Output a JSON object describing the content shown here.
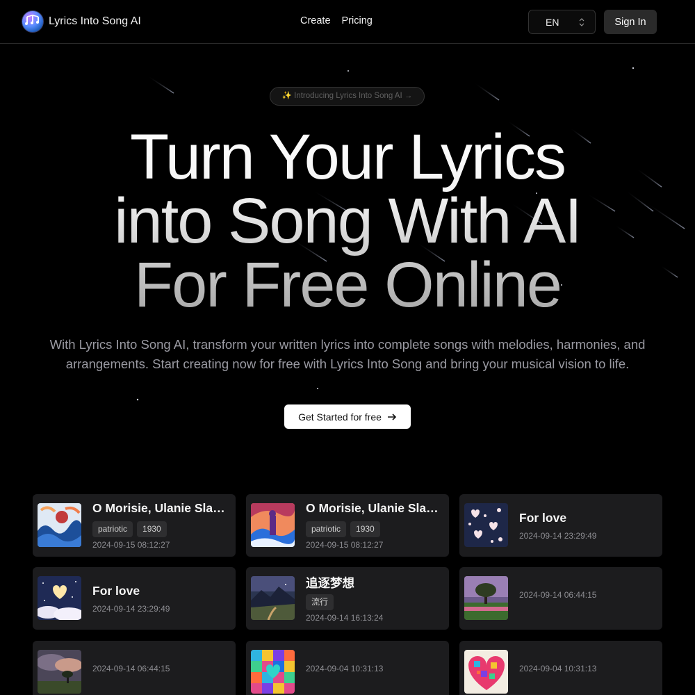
{
  "header": {
    "brand": "Lyrics Into Song AI",
    "nav": [
      "Create",
      "Pricing"
    ],
    "language": "EN",
    "signin": "Sign In"
  },
  "hero": {
    "badge": "✨ Introducing Lyrics Into Song AI →",
    "title_lines": [
      "Turn Your Lyrics",
      "into Song With AI",
      "For Free Online"
    ],
    "subtitle": "With Lyrics Into Song AI, transform your written lyrics into complete songs with melodies, harmonies, and arrangements. Start creating now for free with Lyrics Into Song and bring your musical vision to life.",
    "cta": "Get Started for free"
  },
  "songs": [
    {
      "title": "O Morisie, Ulanie Slawa Twej",
      "tags": [
        "patriotic",
        "1930"
      ],
      "date": "2024-09-15 08:12:27",
      "art": "waves"
    },
    {
      "title": "O Morisie, Ulanie Slawa Twej",
      "tags": [
        "patriotic",
        "1930"
      ],
      "date": "2024-09-15 08:12:27",
      "art": "waves2"
    },
    {
      "title": "For love",
      "tags": [],
      "date": "2024-09-14 23:29:49",
      "art": "hearts"
    },
    {
      "title": "For love",
      "tags": [],
      "date": "2024-09-14 23:29:49",
      "art": "heart-sky"
    },
    {
      "title": "追逐梦想",
      "tags": [
        "流行"
      ],
      "date": "2024-09-14 16:13:24",
      "art": "mountain"
    },
    {
      "title": "",
      "tags": [],
      "date": "2024-09-14 06:44:15",
      "art": "tree"
    },
    {
      "title": "",
      "tags": [],
      "date": "2024-09-14 06:44:15",
      "art": "storm"
    },
    {
      "title": "",
      "tags": [],
      "date": "2024-09-04 10:31:13",
      "art": "mosaic"
    },
    {
      "title": "",
      "tags": [],
      "date": "2024-09-04 10:31:13",
      "art": "mosaic-heart"
    }
  ],
  "colors": {
    "background": "#000000",
    "card": "#1c1c1e",
    "cta": "#ffffff",
    "muted": "#9a9aa2"
  }
}
